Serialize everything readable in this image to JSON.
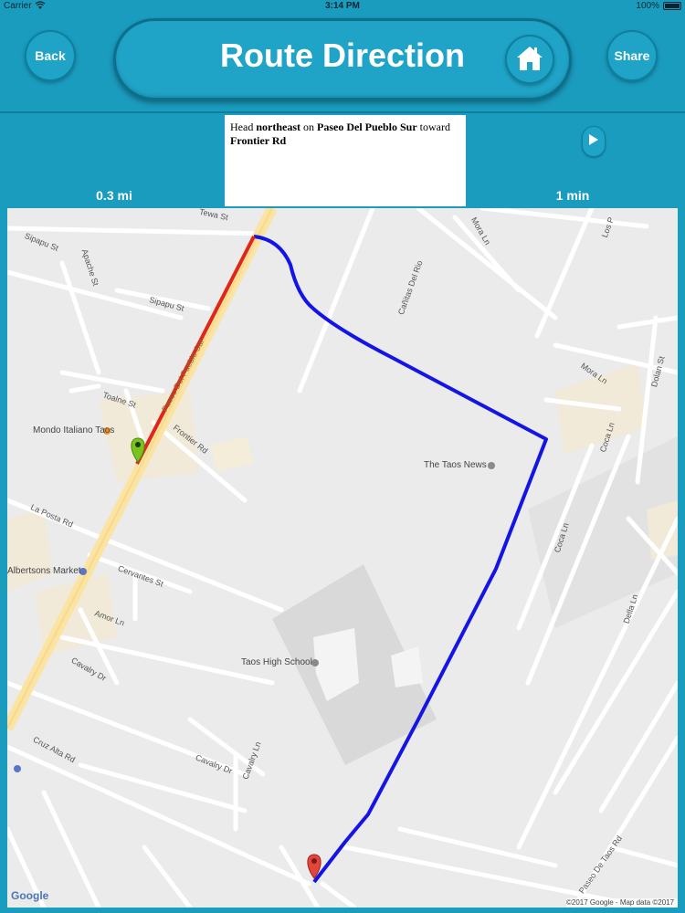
{
  "status_bar": {
    "carrier": "Carrier",
    "time": "3:14 PM",
    "battery": "100%"
  },
  "header": {
    "title": "Route Direction",
    "back_label": "Back",
    "share_label": "Share",
    "home_icon": "home-icon"
  },
  "direction": {
    "instruction_parts": [
      "Head ",
      "northeast",
      " on ",
      "Paseo Del Pueblo Sur",
      " toward ",
      "Frontier Rd"
    ],
    "distance": "0.3 mi",
    "duration": "1 min",
    "next_icon": "play-arrow-icon"
  },
  "map": {
    "streets": [
      "Tewa St",
      "Sipapu St",
      "Apache St",
      "Sipapu St",
      "Toalne St",
      "Paseo Del Pueblo Sur",
      "Frontier Rd",
      "La Posta Rd",
      "Cervantes St",
      "Amor Ln",
      "Cavalry Dr",
      "Cavalry Dr",
      "Cavalry Ln",
      "Cruz Alta Rd",
      "Mora Ln",
      "Los P",
      "Cañitas Del Rio",
      "Mora Ln",
      "Dolan St",
      "Coca Ln",
      "Coca Ln",
      "Della Ln",
      "Paseo De Taos Rd"
    ],
    "pois": [
      "Mondo Italiano Taos",
      "The Taos News",
      "Albertsons Market",
      "Taos High School"
    ],
    "logo": "Google",
    "attribution": "©2017 Google - Map data ©2017 Google",
    "colors": {
      "active_route": "#e0261b",
      "route": "#1414e6",
      "start_marker": "#7cc21e",
      "end_marker": "#e2453c"
    }
  }
}
